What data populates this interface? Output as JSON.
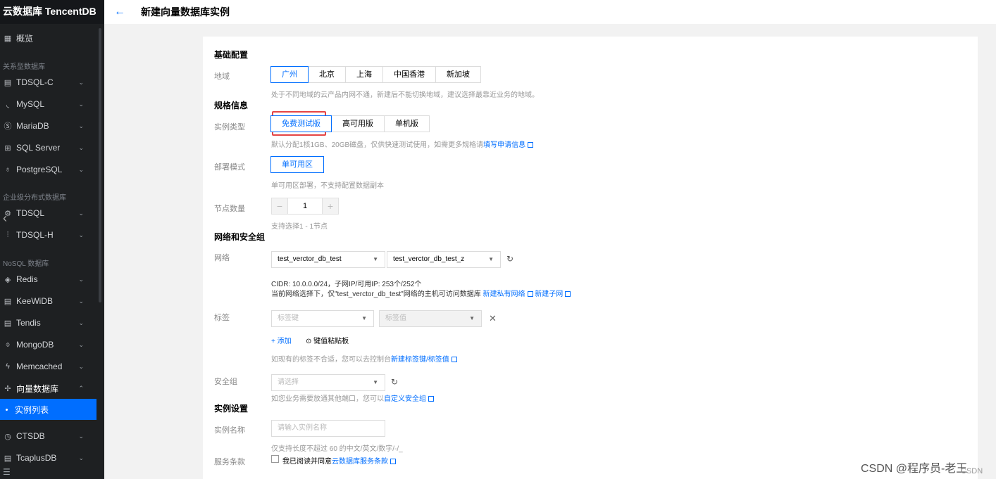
{
  "sidebar": {
    "brand": "云数据库 TencentDB",
    "overview": "概览",
    "group_relational": "关系型数据库",
    "group_distributed": "企业级分布式数据库",
    "group_nosql": "NoSQL 数据库",
    "items": {
      "tdsqlc": "TDSQL-C",
      "mysql": "MySQL",
      "mariadb": "MariaDB",
      "sqlserver": "SQL Server",
      "postgresql": "PostgreSQL",
      "tdsql": "TDSQL",
      "tdsqlh": "TDSQL-H",
      "redis": "Redis",
      "keewidb": "KeeWiDB",
      "tendis": "Tendis",
      "mongodb": "MongoDB",
      "memcached": "Memcached",
      "vectordb": "向量数据库",
      "instance_list": "实例列表",
      "ctsdb": "CTSDB",
      "tcaplusdb": "TcaplusDB"
    }
  },
  "header": {
    "title": "新建向量数据库实例"
  },
  "form": {
    "basic_section": "基础配置",
    "region_label": "地域",
    "regions": [
      "广州",
      "北京",
      "上海",
      "中国香港",
      "新加坡"
    ],
    "region_selected": "广州",
    "region_hint": "处于不同地域的云产品内网不通，新建后不能切换地域，建议选择最靠近业务的地域。",
    "spec_section": "规格信息",
    "instance_type_label": "实例类型",
    "instance_types": [
      "免费测试版",
      "高可用版",
      "单机版"
    ],
    "instance_type_selected": "免费测试版",
    "instance_type_hint": "默认分配1核1GB、20GB磁盘，仅供快速测试使用，如需更多规格请",
    "instance_type_hint_link": "填写申请信息",
    "deploy_label": "部署模式",
    "deploy_option": "单可用区",
    "deploy_hint": "单可用区部署，不支持配置数据副本",
    "node_label": "节点数量",
    "node_minus": "−",
    "node_value": "1",
    "node_plus": "+",
    "node_hint": "支持选择1 - 1节点",
    "network_section": "网络和安全组",
    "network_label": "网络",
    "vpc_value": "test_verctor_db_test",
    "subnet_value": "test_verctor_db_test_z",
    "cidr_text": "CIDR: 10.0.0.0/24，子网IP/可用IP: 253个/252个",
    "network_notice": "当前网络选择下，仅\"test_verctor_db_test\"网络的主机可访问数据库",
    "new_vpc_link": "新建私有网络",
    "new_subnet_link": "新建子网",
    "tag_label": "标签",
    "tag_key_placeholder": "标签键",
    "tag_value_placeholder": "标签值",
    "add_link": "+ 添加",
    "paste_link": "键值粘贴板",
    "tag_hint": "如现有的标签不合适，您可以去控制台",
    "tag_hint_link": "新建标签键/标签值",
    "security_label": "安全组",
    "security_placeholder": "请选择",
    "security_hint": "如您业务需要放通其他端口，您可以",
    "security_hint_link": "自定义安全组",
    "instance_section": "实例设置",
    "name_label": "实例名称",
    "name_placeholder": "请输入实例名称",
    "name_hint": "仅支持长度不超过 60 的中文/英文/数字/-/_",
    "terms_label": "服务条款",
    "terms_text": "我已阅读并同意",
    "terms_link": "云数据库服务条款"
  },
  "watermark": "CSDN @程序员-老王",
  "watermark2": "CSDN"
}
